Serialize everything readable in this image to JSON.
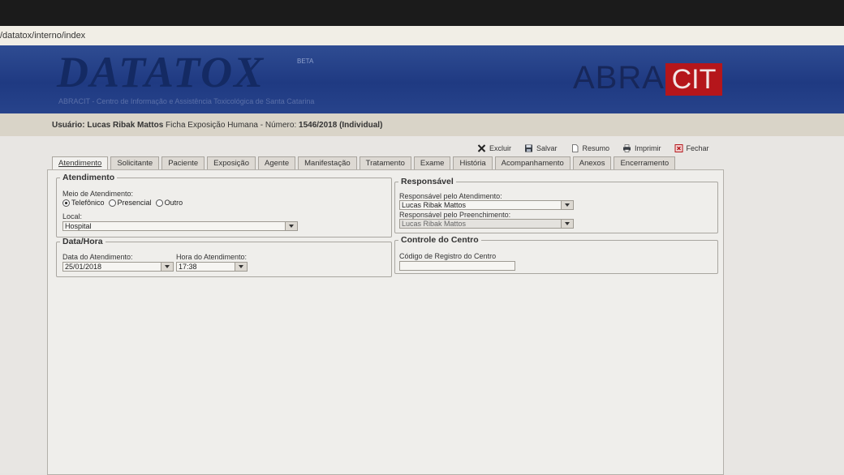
{
  "browser": {
    "url": "/datatox/interno/index"
  },
  "banner": {
    "logo": "DATATOX",
    "beta": "BETA",
    "tagline": "ABRACIT - Centro de Informação e Assistência Toxicológica de Santa Catarina",
    "abra": "ABRA",
    "cit": "CIT"
  },
  "info": {
    "user_label": "Usuário:",
    "user_name": "Lucas Ribak Mattos",
    "form_text": "Ficha Exposição Humana - Número:",
    "number": "1546/2018 (Individual)"
  },
  "toolbar": [
    {
      "label": "Excluir",
      "icon": "delete-icon",
      "color": "#222222"
    },
    {
      "label": "Salvar",
      "icon": "save-icon",
      "color": "#3a3f46"
    },
    {
      "label": "Resumo",
      "icon": "document-icon",
      "color": "#555555"
    },
    {
      "label": "Imprimir",
      "icon": "printer-icon",
      "color": "#3a3f46"
    },
    {
      "label": "Fechar",
      "icon": "close-icon",
      "color": "#b5161b"
    }
  ],
  "tabs": [
    "Atendimento",
    "Solicitante",
    "Paciente",
    "Exposição",
    "Agente",
    "Manifestação",
    "Tratamento",
    "Exame",
    "História",
    "Acompanhamento",
    "Anexos",
    "Encerramento"
  ],
  "active_tab": "Atendimento",
  "atendimento": {
    "title": "Atendimento",
    "meio_label": "Meio de Atendimento:",
    "options": [
      "Telefônico",
      "Presencial",
      "Outro"
    ],
    "selected": "Telefônico",
    "local_label": "Local:",
    "local_value": "Hospital"
  },
  "data_hora": {
    "title": "Data/Hora",
    "data_label": "Data do Atendimento:",
    "data_value": "25/01/2018",
    "hora_label": "Hora do Atendimento:",
    "hora_value": "17:38"
  },
  "responsavel": {
    "title": "Responsável",
    "atendimento_label": "Responsável pelo Atendimento:",
    "atendimento_value": "Lucas Ribak Mattos",
    "preenchimento_label": "Responsável pelo Preenchimento:",
    "preenchimento_value": "Lucas Ribak Mattos"
  },
  "controle": {
    "title": "Controle do Centro",
    "codigo_label": "Código de Registro do Centro",
    "codigo_value": ""
  },
  "colors": {
    "banner_blue": "#24408a",
    "cit_red": "#b5161b",
    "panel_bg": "#efeeeb"
  }
}
